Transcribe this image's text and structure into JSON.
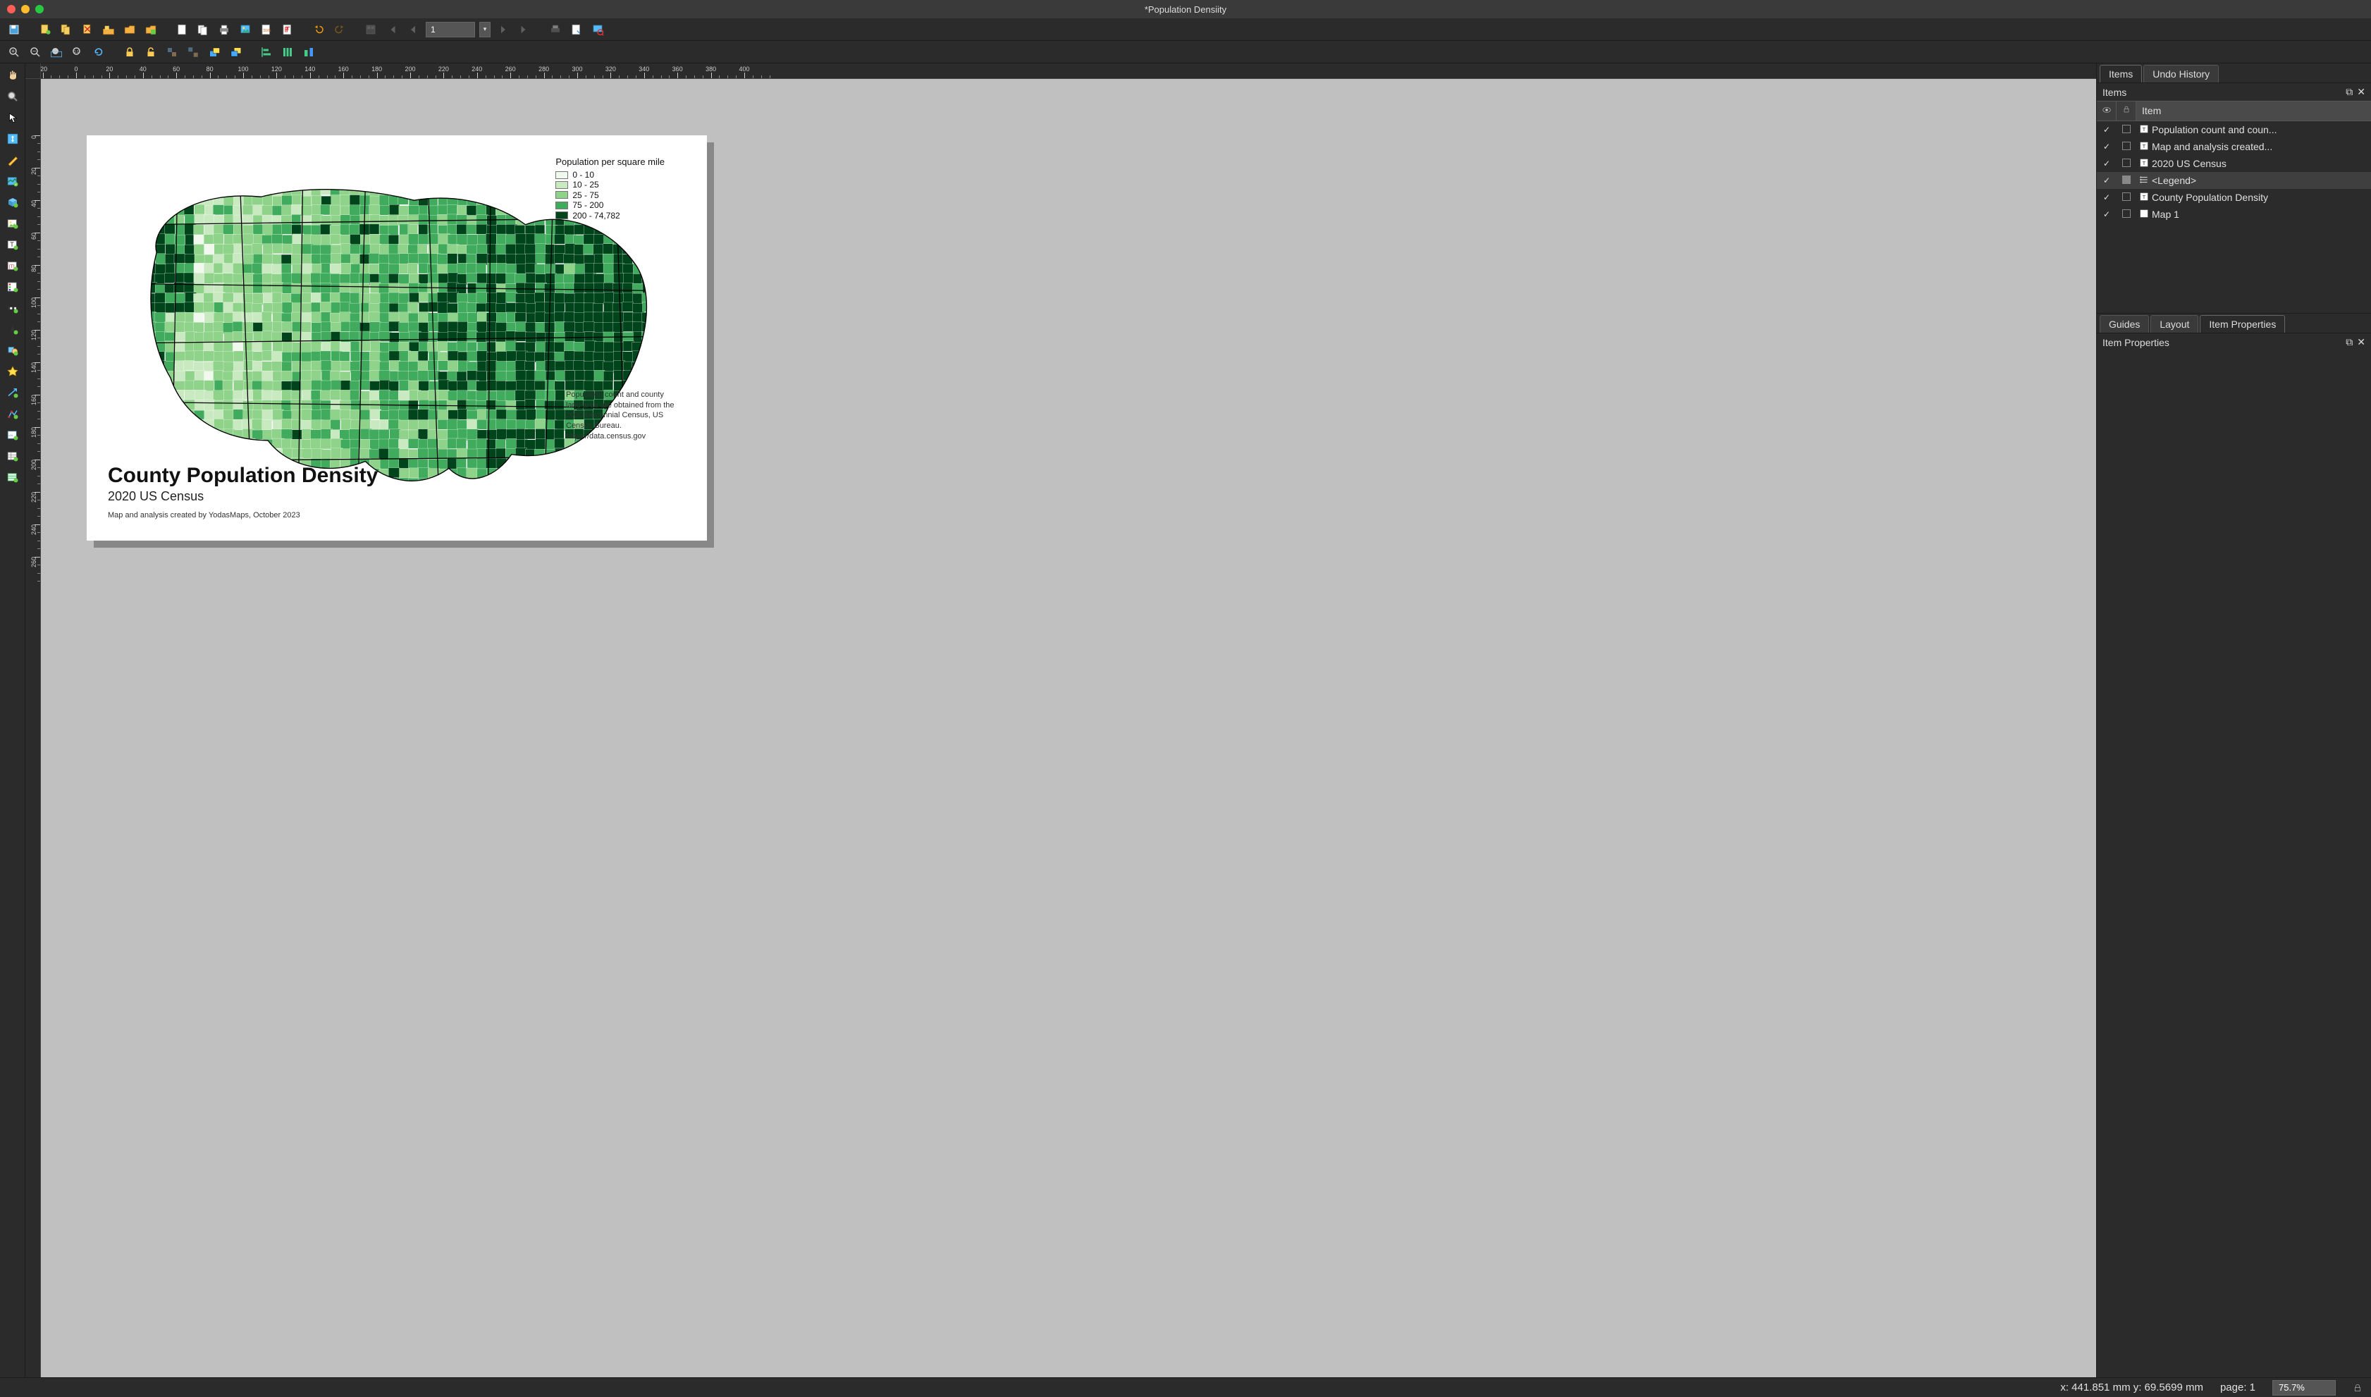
{
  "window": {
    "title": "*Population Densiity"
  },
  "toolbar1": {
    "save": "save",
    "new": "new-layout",
    "dup": "duplicate-layout",
    "del": "delete-layout",
    "mgr": "layout-manager",
    "open": "open",
    "openproj": "open-project",
    "settings": "layout-settings",
    "addpages": "add-pages",
    "print": "print",
    "export_img": "export-image",
    "export_svg": "export-svg",
    "export_pdf": "export-pdf",
    "undo": "undo",
    "redo": "redo",
    "atlas": "atlas-settings",
    "first": "first-feature",
    "prev": "prev-feature",
    "page_value": "1",
    "next": "next-feature",
    "last": "last-feature",
    "export_atlas": "export-atlas",
    "atlas_settings": "atlas-preview",
    "preview": "preview-atlas"
  },
  "toolbar2": {
    "zoomin": "zoom-in",
    "zoomout": "zoom-out",
    "zoomfull": "zoom-full",
    "zoom100": "zoom-100",
    "refresh": "refresh",
    "lock": "lock-items",
    "unlock": "unlock-items",
    "group": "group",
    "ungroup": "ungroup",
    "raise": "raise",
    "lower": "lower",
    "align": "align-items",
    "distribute": "distribute",
    "resize": "resize"
  },
  "tools": [
    "pan",
    "zoom",
    "select",
    "move-content",
    "edit-nodes",
    "add-map",
    "add-3dmap",
    "add-picture",
    "add-label",
    "add-legend",
    "add-scalebar",
    "add-north",
    "add-shape",
    "add-arrow",
    "add-nodes",
    "add-html",
    "add-table",
    "add-attribute",
    "add-fixed-table"
  ],
  "map_layout": {
    "title": "County Population Density",
    "subtitle": "2020 US Census",
    "credit": "Map and analysis created by YodasMaps, October 2023",
    "source": "Population count and county land area are obtained from the 2020 Decennial Census, US Census Bureau. https://data.census.gov",
    "legend": {
      "title": "Population per square mile",
      "bins": [
        {
          "label": "0 - 10",
          "color": "#f1f9ee"
        },
        {
          "label": "10 - 25",
          "color": "#c9e9c1"
        },
        {
          "label": "25 - 75",
          "color": "#8fd28a"
        },
        {
          "label": "75 - 200",
          "color": "#41ab5d"
        },
        {
          "label": "200 - 74,782",
          "color": "#00441b"
        }
      ]
    }
  },
  "panels": {
    "tabs_items": {
      "items": "Items",
      "undo": "Undo History"
    },
    "items_header": "Items",
    "items_cols": {
      "eye": "eye",
      "lock": "lock",
      "item": "Item"
    },
    "items": [
      {
        "name": "Population count and coun...",
        "icon": "T",
        "visible": true,
        "locked": false,
        "selected": false
      },
      {
        "name": "Map and analysis created...",
        "icon": "T",
        "visible": true,
        "locked": false,
        "selected": false
      },
      {
        "name": "2020 US Census",
        "icon": "T",
        "visible": true,
        "locked": false,
        "selected": false
      },
      {
        "name": "<Legend>",
        "icon": "legend",
        "visible": true,
        "locked": true,
        "selected": true
      },
      {
        "name": "County Population Density",
        "icon": "T",
        "visible": true,
        "locked": false,
        "selected": false
      },
      {
        "name": "Map 1",
        "icon": "map",
        "visible": true,
        "locked": false,
        "selected": false
      }
    ],
    "tabs_props": {
      "guides": "Guides",
      "layout": "Layout",
      "props": "Item Properties"
    },
    "props_header": "Item Properties"
  },
  "status": {
    "coords": "x: 441.851 mm y: 69.5699 mm",
    "page": "page: 1",
    "zoom": "75.7%"
  },
  "ruler": {
    "top_marks": [
      -20,
      0,
      20,
      40,
      60,
      80,
      100,
      120,
      140,
      160,
      180,
      200,
      220,
      240,
      260,
      280,
      300,
      320,
      340,
      360,
      380,
      400
    ],
    "left_marks": [
      0,
      20,
      40,
      60,
      80,
      100,
      120,
      140,
      160,
      180,
      200,
      220,
      240,
      260
    ]
  }
}
